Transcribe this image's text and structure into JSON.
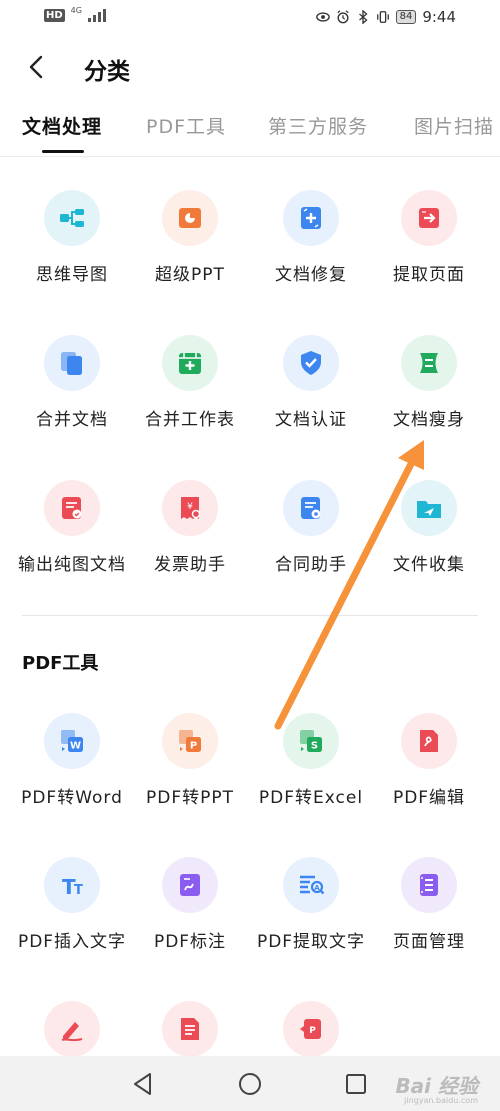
{
  "status_bar": {
    "hd": "HD",
    "network": "4G",
    "battery": "84",
    "time": "9:44"
  },
  "header": {
    "title": "分类"
  },
  "tabs": [
    {
      "label": "文档处理",
      "active": true
    },
    {
      "label": "PDF工具",
      "active": false
    },
    {
      "label": "第三方服务",
      "active": false
    },
    {
      "label": "图片扫描",
      "active": false
    }
  ],
  "doc_items": [
    {
      "label": "思维导图",
      "icon": "mindmap-icon",
      "bg": "#e3f4f8",
      "color": "#1fb6d4"
    },
    {
      "label": "超级PPT",
      "icon": "ppt-icon",
      "bg": "#fdeee7",
      "color": "#f07a3a"
    },
    {
      "label": "文档修复",
      "icon": "doc-repair-icon",
      "bg": "#e7f0fd",
      "color": "#3d86f0"
    },
    {
      "label": "提取页面",
      "icon": "extract-page-icon",
      "bg": "#fde9ea",
      "color": "#ea4b55"
    },
    {
      "label": "合并文档",
      "icon": "merge-doc-icon",
      "bg": "#e7f0fd",
      "color": "#3d86f0"
    },
    {
      "label": "合并工作表",
      "icon": "merge-sheet-icon",
      "bg": "#e4f6ec",
      "color": "#1faa5c"
    },
    {
      "label": "文档认证",
      "icon": "shield-check-icon",
      "bg": "#e7f0fd",
      "color": "#3d86f0"
    },
    {
      "label": "文档瘦身",
      "icon": "doc-slim-icon",
      "bg": "#e4f6ec",
      "color": "#1faa5c"
    },
    {
      "label": "输出纯图文档",
      "icon": "image-doc-icon",
      "bg": "#fde9ea",
      "color": "#ea4b55"
    },
    {
      "label": "发票助手",
      "icon": "invoice-icon",
      "bg": "#fde9ea",
      "color": "#ea4b55"
    },
    {
      "label": "合同助手",
      "icon": "contract-icon",
      "bg": "#e7f0fd",
      "color": "#3d86f0"
    },
    {
      "label": "文件收集",
      "icon": "folder-send-icon",
      "bg": "#e3f4f8",
      "color": "#1fb6d4"
    }
  ],
  "pdf_section": {
    "title": "PDF工具"
  },
  "pdf_items": [
    {
      "label": "PDF转Word",
      "icon": "pdf-to-word-icon",
      "bg": "#e7f0fd",
      "color": "#3d86f0"
    },
    {
      "label": "PDF转PPT",
      "icon": "pdf-to-ppt-icon",
      "bg": "#fdeee7",
      "color": "#f07a3a"
    },
    {
      "label": "PDF转Excel",
      "icon": "pdf-to-excel-icon",
      "bg": "#e4f6ec",
      "color": "#1faa5c"
    },
    {
      "label": "PDF编辑",
      "icon": "pdf-edit-icon",
      "bg": "#fde9ea",
      "color": "#ea4b55"
    },
    {
      "label": "PDF插入文字",
      "icon": "insert-text-icon",
      "bg": "#e7f0fd",
      "color": "#3d86f0"
    },
    {
      "label": "PDF标注",
      "icon": "annotate-icon",
      "bg": "#efe9fb",
      "color": "#8b5cf0"
    },
    {
      "label": "PDF提取文字",
      "icon": "extract-text-icon",
      "bg": "#e7f0fd",
      "color": "#3d86f0"
    },
    {
      "label": "页面管理",
      "icon": "page-manage-icon",
      "bg": "#efe9fb",
      "color": "#8b5cf0"
    },
    {
      "label": "",
      "icon": "pdf-sign-icon",
      "bg": "#fde9ea",
      "color": "#ea4b55"
    },
    {
      "label": "",
      "icon": "pdf-form-icon",
      "bg": "#fde9ea",
      "color": "#ea4b55"
    },
    {
      "label": "",
      "icon": "pdf-convert-icon",
      "bg": "#fde9ea",
      "color": "#ea4b55"
    }
  ],
  "watermark": {
    "text": "Bai 经验",
    "sub": "jingyan.baidu.com"
  },
  "annotation_color": "#f5923a"
}
